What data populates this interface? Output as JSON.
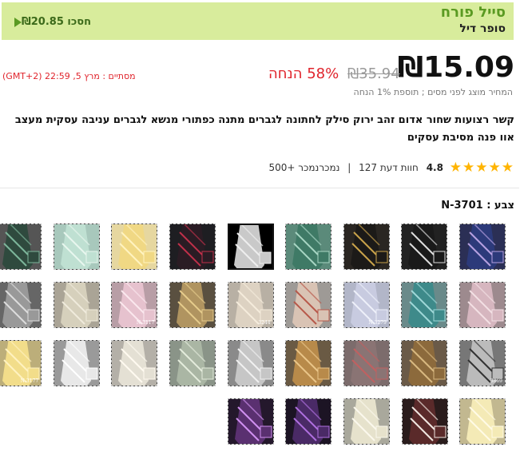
{
  "banner": {
    "title": "סייל פורח",
    "subtitle": "סופר דיל",
    "savings": "₪20.85 חסכו"
  },
  "pricing": {
    "current_price": "₪15.09",
    "original_price": "₪35.94",
    "discount": "58% הנחה",
    "countdown": "מסתיים : מרץ 5, 22:59 (GMT+2)",
    "tax_note": "המחיר מוצג לפני מסים ; תוספת 1% הנחה"
  },
  "product": {
    "title": "קשר רצועות שחור אדום זהב ירוק סילק לחתונה לגברים מתנה כפתורי מנשא לגברים עניבה עסקית מעצב אוו פנה מסיבת עסקים",
    "rating": "4.8",
    "stars": "★★★★★",
    "reviews": "127 חוות דעת",
    "sold": "500+ נמכרנמכר"
  },
  "colors": {
    "label": "צבע : N-3701",
    "swatches": [
      {
        "name": "navy-stripe",
        "bg": "#2b2f55",
        "tie": "#2c3a7a",
        "accent": "#b6a0e0",
        "selected": false,
        "code": ""
      },
      {
        "name": "black-white-stripe",
        "bg": "#222",
        "tie": "#1a1a1a",
        "accent": "#ddd",
        "selected": false,
        "code": ""
      },
      {
        "name": "black-gold-stripe",
        "bg": "#2a2622",
        "tie": "#1c1a18",
        "accent": "#c9a24a",
        "selected": false,
        "code": ""
      },
      {
        "name": "green-diamond",
        "bg": "#5b8a7a",
        "tie": "#3f7a66",
        "accent": "#a8d6c4",
        "selected": false,
        "code": ""
      },
      {
        "name": "silver-selected",
        "bg": "#000",
        "tie": "#c9c9c9",
        "accent": "#eee",
        "selected": true,
        "code": ""
      },
      {
        "name": "black-red-stripe",
        "bg": "#1e1e22",
        "tie": "#2a1c24",
        "accent": "#c0304a",
        "selected": false,
        "code": ""
      },
      {
        "name": "yellow-stripe",
        "bg": "#e6d7a0",
        "tie": "#f0d884",
        "accent": "#fff3c0",
        "selected": false,
        "code": ""
      },
      {
        "name": "mint-paisley",
        "bg": "#a8c8bc",
        "tie": "#bfe0d2",
        "accent": "#e8f6ee",
        "selected": false,
        "code": ""
      },
      {
        "name": "dark-green-stripe",
        "bg": "#555",
        "tie": "#2f4a3e",
        "accent": "#7cb59a",
        "selected": false,
        "code": ""
      },
      {
        "name": "pink-floral",
        "bg": "#9d8a8e",
        "tie": "#d6b6bf",
        "accent": "#f3e0e4",
        "selected": false,
        "code": ""
      },
      {
        "name": "teal-stripe",
        "bg": "#6a8a8a",
        "tie": "#3e8a8a",
        "accent": "#9fd8d8",
        "selected": false,
        "code": ""
      },
      {
        "name": "lavender-floral",
        "bg": "#b2b6c8",
        "tie": "#c8cbe0",
        "accent": "#eef0fa",
        "selected": false,
        "code": "N-3279"
      },
      {
        "name": "peach-stripe",
        "bg": "#9e9a96",
        "tie": "#d9c3b4",
        "accent": "#b7584a",
        "selected": false,
        "code": ""
      },
      {
        "name": "cream-paisley",
        "bg": "#b8b0a4",
        "tie": "#ddd2c2",
        "accent": "#f5ecdc",
        "selected": false,
        "code": "3244"
      },
      {
        "name": "gold-paisley",
        "bg": "#5a5040",
        "tie": "#b09460",
        "accent": "#e6cc8c",
        "selected": false,
        "code": ""
      },
      {
        "name": "pink-check",
        "bg": "#b89ea6",
        "tie": "#e6c2ce",
        "accent": "#fbe8ee",
        "selected": false,
        "code": "N-3117"
      },
      {
        "name": "beige-pattern",
        "bg": "#aaa496",
        "tie": "#d6d0bc",
        "accent": "#f0ebdc",
        "selected": false,
        "code": ""
      },
      {
        "name": "grey-check",
        "bg": "#666",
        "tie": "#999",
        "accent": "#ddd",
        "selected": false,
        "code": ""
      },
      {
        "name": "silver-stripe",
        "bg": "#777",
        "tie": "#bbb",
        "accent": "#333",
        "selected": false,
        "code": "3869"
      },
      {
        "name": "brown-check",
        "bg": "#6a5a48",
        "tie": "#8c6a3c",
        "accent": "#d8b880",
        "selected": false,
        "code": ""
      },
      {
        "name": "grey-red-stripe",
        "bg": "#7c6c6c",
        "tie": "#8a7474",
        "accent": "#c06060",
        "selected": false,
        "code": ""
      },
      {
        "name": "gold-brown-paisley",
        "bg": "#6a5a44",
        "tie": "#b88a4a",
        "accent": "#eac68a",
        "selected": false,
        "code": ""
      },
      {
        "name": "silver-floral",
        "bg": "#8a8a8a",
        "tie": "#c6c6c6",
        "accent": "#f0f0f0",
        "selected": false,
        "code": ""
      },
      {
        "name": "sage-stripe",
        "bg": "#8a9488",
        "tie": "#aab6a4",
        "accent": "#e4ecdc",
        "selected": false,
        "code": ""
      },
      {
        "name": "ivory-paisley",
        "bg": "#b4b0a8",
        "tie": "#e4e0d4",
        "accent": "#fffaf0",
        "selected": false,
        "code": ""
      },
      {
        "name": "white-silver",
        "bg": "#9a9a9a",
        "tie": "#e8e8e8",
        "accent": "#ffffff",
        "selected": false,
        "code": ""
      },
      {
        "name": "yellow-solid",
        "bg": "#bcae7a",
        "tie": "#f2dd8a",
        "accent": "#fff2c0",
        "selected": false,
        "code": "N-3177"
      },
      {
        "name": "pale-yellow",
        "bg": "#c2b890",
        "tie": "#f4eab6",
        "accent": "#fffbe6",
        "selected": false,
        "code": ""
      },
      {
        "name": "burgundy-stripe",
        "bg": "#2a1c1c",
        "tie": "#5a2a2a",
        "accent": "#f0e6e0",
        "selected": false,
        "code": ""
      },
      {
        "name": "cream-stripe",
        "bg": "#a9a89c",
        "tie": "#e6e2cc",
        "accent": "#fbf8ec",
        "selected": false,
        "code": ""
      },
      {
        "name": "purple-stripe",
        "bg": "#1c1424",
        "tie": "#4a2a66",
        "accent": "#b070e0",
        "selected": false,
        "code": ""
      },
      {
        "name": "plum-stripe",
        "bg": "#24182c",
        "tie": "#5a3070",
        "accent": "#d090f0",
        "selected": false,
        "code": ""
      }
    ]
  }
}
